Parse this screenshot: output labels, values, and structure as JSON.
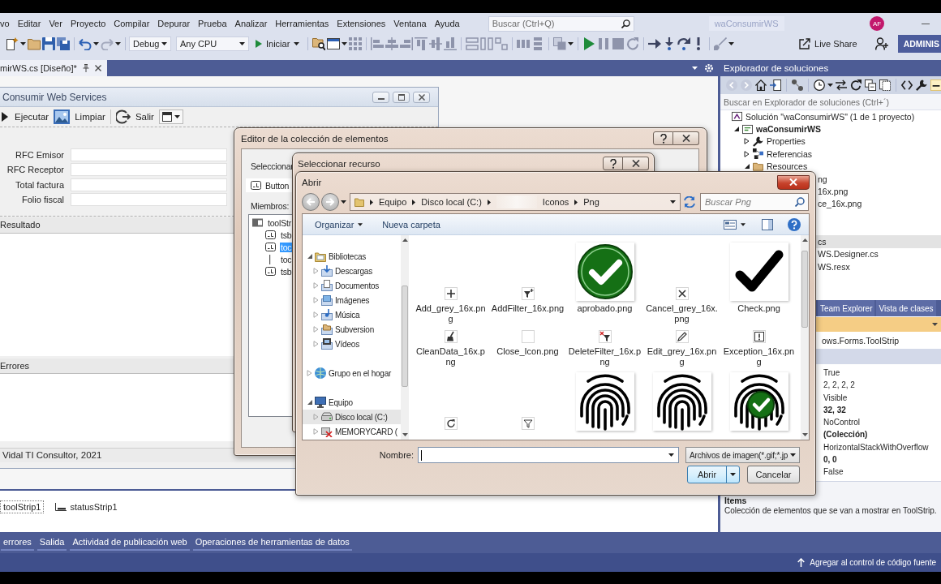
{
  "menu_bar": {
    "items": [
      "vo",
      "Editar",
      "Ver",
      "Proyecto",
      "Compilar",
      "Depurar",
      "Prueba",
      "Analizar",
      "Herramientas",
      "Extensiones",
      "Ventana",
      "Ayuda"
    ],
    "search": {
      "placeholder": "Buscar (Ctrl+Q)"
    },
    "solution_title": "waConsumirWS",
    "avatar": "AF"
  },
  "toolbar": {
    "configuration": "Debug",
    "platform": "Any CPU",
    "start": "Iniciar",
    "live_share": "Live Share",
    "account": "ADMINIS"
  },
  "document_tabs": [
    {
      "label": "mirWS.cs [Diseño]*",
      "selected": true
    }
  ],
  "form_window": {
    "title": "Consumir Web Services",
    "tools": [
      {
        "label": "Ejecutar",
        "kind": "play"
      },
      {
        "label": "Limpiar",
        "kind": "picture"
      },
      {
        "label": "Salir",
        "kind": "exit"
      },
      {
        "kind": "dropdown"
      }
    ],
    "fields": [
      {
        "label": "RFC Emisor"
      },
      {
        "label": "RFC Receptor"
      },
      {
        "label": "Total factura"
      },
      {
        "label": "Folio fiscal"
      }
    ],
    "groups": [
      {
        "title": "Resultado"
      },
      {
        "title": "Errores"
      }
    ],
    "status": "Vidal TI Consultor, 2021"
  },
  "component_tray": [
    {
      "label": "toolStrip1",
      "kind": "toolstrip",
      "selected": true
    },
    {
      "label": "statusStrip1",
      "kind": "statusstrip",
      "selected": false
    }
  ],
  "collection_editor": {
    "title": "Editor de la colección de elementos",
    "select_label": "Seleccionar",
    "item_type": "Button",
    "members_label": "Miembros:",
    "members": [
      {
        "label": "toolStr",
        "kind": "toolstrip",
        "selected": false,
        "children": [
          {
            "label": "tsb",
            "kind": "button",
            "selected": false
          },
          {
            "label": "toc",
            "kind": "button",
            "selected": true
          },
          {
            "label": "toc",
            "kind": "separator",
            "selected": false
          },
          {
            "label": "tsb",
            "kind": "button",
            "selected": false
          }
        ]
      }
    ]
  },
  "resource_dialog": {
    "title": "Seleccionar recurso"
  },
  "open_dialog": {
    "title": "Abrir",
    "path": [
      {
        "kind": "folder",
        "label": "Equipo"
      },
      {
        "kind": "folder",
        "label": "Disco local (C:)"
      },
      {
        "kind": "blurred"
      },
      {
        "kind": "folder",
        "label": "Iconos"
      },
      {
        "kind": "folder",
        "label": "Png"
      }
    ],
    "search": {
      "placeholder": "Buscar Png"
    },
    "commands": [
      {
        "label": "Organizar",
        "kind": "menu"
      },
      {
        "label": "Nueva carpeta",
        "kind": "plain"
      }
    ],
    "navigation": [
      {
        "label": "Bibliotecas",
        "kind": "library",
        "expanded": true,
        "selected": false,
        "children": [
          {
            "label": "Descargas",
            "kind": "downloads",
            "expanded": false,
            "selected": false
          },
          {
            "label": "Documentos",
            "kind": "documents",
            "expanded": false,
            "selected": false
          },
          {
            "label": "Imágenes",
            "kind": "pictures",
            "expanded": false,
            "selected": false
          },
          {
            "label": "Música",
            "kind": "music",
            "expanded": false,
            "selected": false
          },
          {
            "label": "Subversion",
            "kind": "folder",
            "expanded": false,
            "selected": false
          },
          {
            "label": "Vídeos",
            "kind": "videos",
            "expanded": false,
            "selected": false
          }
        ]
      },
      {
        "label": "Grupo en el hogar",
        "kind": "homegroup",
        "expanded": false,
        "selected": false
      },
      {
        "label": "Equipo",
        "kind": "computer",
        "expanded": true,
        "selected": false,
        "children": [
          {
            "label": "Disco local (C:)",
            "kind": "drive",
            "expanded": false,
            "selected": true
          },
          {
            "label": "MEMORYCARD (",
            "kind": "card",
            "expanded": false,
            "selected": false
          }
        ]
      }
    ],
    "files": [
      {
        "name": "Add_grey_16x.png",
        "kind": "plus"
      },
      {
        "name": "AddFilter_16x.png",
        "kind": "filter-add"
      },
      {
        "name": "aprobado.png",
        "kind": "approved-check"
      },
      {
        "name": "Cancel_grey_16x.png",
        "kind": "cross"
      },
      {
        "name": "Check.png",
        "kind": "check"
      },
      {
        "name": "CleanData_16x.png",
        "kind": "broom"
      },
      {
        "name": "Close_Icon.png",
        "kind": "blank"
      },
      {
        "name": "DeleteFilter_16x.png",
        "kind": "filter-delete"
      },
      {
        "name": "Edit_grey_16x.png",
        "kind": "pencil"
      },
      {
        "name": "Exception_16x.png",
        "kind": "exclamation"
      },
      {
        "kind": "refresh"
      },
      {
        "kind": "filter"
      },
      {
        "kind": "fingerprint"
      },
      {
        "kind": "fingerprint"
      },
      {
        "kind": "fingerprint-check"
      }
    ],
    "name_label": "Nombre:",
    "file_type": "Archivos de imagen(*.gif;*.jp",
    "buttons": [
      {
        "label": "Abrir",
        "kind": "split"
      },
      {
        "label": "Cancelar",
        "kind": "plain"
      }
    ]
  },
  "solution_explorer": {
    "title": "Explorador de soluciones",
    "search": {
      "placeholder": "Buscar en Explorador de soluciones (Ctrl+´)"
    },
    "tree": [
      {
        "label": "Solución \"waConsumirWS\" (1 de 1 proyecto)",
        "kind": "solution",
        "selected": false,
        "children": [
          {
            "label": "waConsumirWS",
            "kind": "project",
            "expanded": true,
            "selected": false,
            "children": [
              {
                "label": "Properties",
                "kind": "properties",
                "expanded": false,
                "selected": false
              },
              {
                "label": "Referencias",
                "kind": "references",
                "expanded": false,
                "selected": false
              },
              {
                "label": "Resources",
                "kind": "folder",
                "expanded": true,
                "selected": false,
                "children": [
                  {
                    "label": "ng",
                    "kind": "covered",
                    "selected": false
                  },
                  {
                    "label": "16x.png",
                    "kind": "covered",
                    "selected": false
                  },
                  {
                    "label": "ce_16x.png",
                    "kind": "covered",
                    "selected": false
                  }
                ]
              },
              {
                "label": "cs",
                "kind": "covered",
                "selected": true,
                "children": [
                  {
                    "label": "WS.Designer.cs",
                    "kind": "covered",
                    "selected": false
                  },
                  {
                    "label": "WS.resx",
                    "kind": "covered",
                    "selected": false
                  }
                ]
              }
            ]
          }
        ]
      }
    ]
  },
  "panel_tabs": [
    {
      "label": "Team Explorer",
      "selected": false
    },
    {
      "label": "Vista de clases",
      "selected": false
    }
  ],
  "properties": {
    "object": "ows.Forms.ToolStrip",
    "values": [
      {
        "value": "True",
        "modified": false
      },
      {
        "value": "2, 2, 2, 2",
        "modified": false
      },
      {
        "value": "Visible",
        "modified": false
      },
      {
        "value": "32, 32",
        "modified": true
      },
      {
        "value": "NoControl",
        "modified": false
      },
      {
        "value": "(Colección)",
        "modified": true
      },
      {
        "value": "HorizontalStackWithOverflow",
        "modified": false
      },
      {
        "value": "0, 0",
        "modified": true
      },
      {
        "value": "False",
        "modified": false
      }
    ],
    "description": {
      "title": "Items",
      "text": "Colección de elementos que se van a mostrar en ToolStrip."
    }
  },
  "tool_tabs": [
    {
      "label": "errores",
      "selected": false
    },
    {
      "label": "Salida",
      "selected": false
    },
    {
      "label": "Actividad de publicación web",
      "selected": false
    },
    {
      "label": "Operaciones de herramientas de datos",
      "selected": false
    }
  ],
  "status_bar": {
    "source_control": "Agregar al control de código fuente"
  }
}
